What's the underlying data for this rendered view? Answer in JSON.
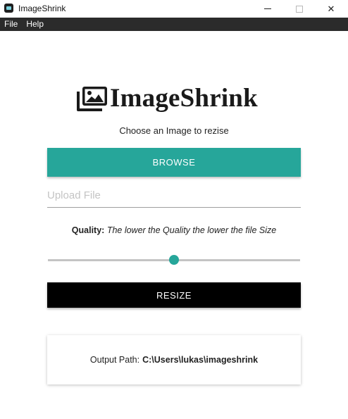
{
  "window": {
    "title": "ImageShrink",
    "minimize_glyph": "—",
    "close_glyph": "✕"
  },
  "menubar": {
    "items": [
      {
        "label": "File"
      },
      {
        "label": "Help"
      }
    ]
  },
  "logo": {
    "icon": "images-icon",
    "text": "ImageShrink"
  },
  "subtitle": "Choose an Image to rezise",
  "browse": {
    "label": "BROWSE"
  },
  "upload": {
    "placeholder": "Upload File",
    "value": ""
  },
  "quality": {
    "label": "Quality:",
    "hint": "The lower the Quality the lower the file Size",
    "slider_value": 0.5
  },
  "resize": {
    "label": "RESIZE"
  },
  "output": {
    "label": "Output Path:",
    "path": "C:\\Users\\lukas\\imageshrink"
  },
  "colors": {
    "accent": "#26a69a",
    "menubar": "#2b2b2b",
    "resize_button": "#000000"
  }
}
